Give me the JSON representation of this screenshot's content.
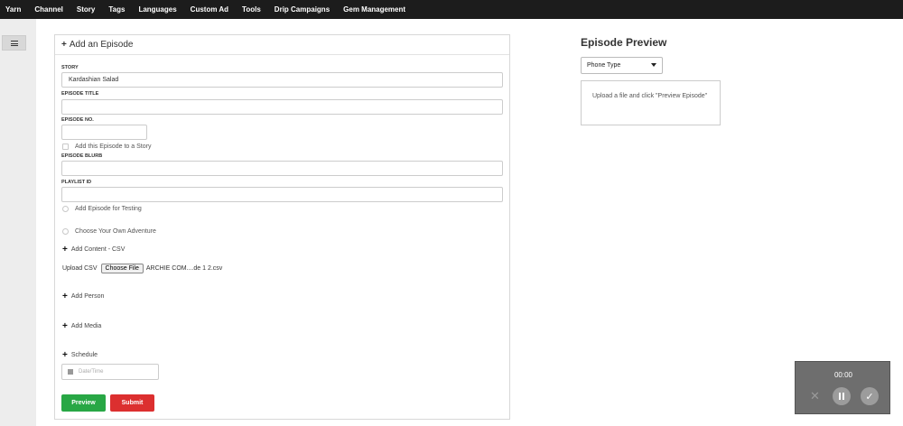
{
  "topnav": [
    "Yarn",
    "Channel",
    "Story",
    "Tags",
    "Languages",
    "Custom Ad",
    "Tools",
    "Drip Campaigns",
    "Gem Management"
  ],
  "form": {
    "title": "Add an Episode",
    "story_label": "STORY",
    "story_value": "Kardashian Salad",
    "episode_title_label": "EPISODE TITLE",
    "episode_title_value": "",
    "episode_no_label": "EPISODE NO.",
    "episode_no_value": "",
    "add_to_story": "Add this Episode to a Story",
    "blurb_label": "EPISODE BLURB",
    "blurb_value": "",
    "playlist_label": "PLAYLIST ID",
    "playlist_value": "",
    "add_for_testing": "Add Episode for Testing",
    "choose_adventure": "Choose Your Own Adventure",
    "add_content_csv": "Add Content - CSV",
    "upload_csv_label": "Upload CSV",
    "choose_file": "Choose File",
    "file_name": "ARCHIE COM....de 1 2.csv",
    "add_person": "Add Person",
    "add_media": "Add Media",
    "schedule": "Schedule",
    "date_placeholder": "Date/Time",
    "preview_button": "Preview",
    "submit_button": "Submit"
  },
  "preview": {
    "title": "Episode Preview",
    "phone_type": "Phone Type",
    "message": "Upload a file and click \"Preview Episode\""
  },
  "recorder": {
    "time": "00:00"
  },
  "colors": {
    "nav_bg": "#1c1c1c",
    "preview_btn": "#28a745",
    "submit_btn": "#dc2f2f"
  }
}
